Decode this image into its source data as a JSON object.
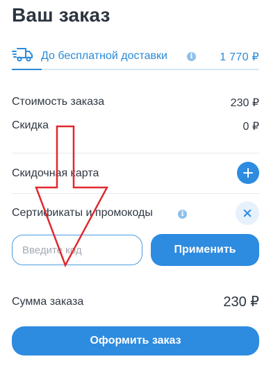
{
  "title": "Ваш заказ",
  "delivery": {
    "label": "До бесплатной доставки",
    "amount": "1 770 ₽",
    "progress_fraction": 0.12,
    "icon": "truck-icon"
  },
  "summary": {
    "cost_label": "Стоимость заказа",
    "cost_value": "230 ₽",
    "discount_label": "Скидка",
    "discount_value": "0 ₽"
  },
  "discount_card": {
    "label": "Скидочная карта",
    "icon": "plus-icon"
  },
  "promo": {
    "label": "Сертификаты и промокоды",
    "input_placeholder": "Введите код",
    "apply_label": "Применить",
    "icon": "close-icon"
  },
  "total": {
    "label": "Сумма заказа",
    "value": "230 ₽"
  },
  "checkout_label": "Оформить заказ",
  "info_glyph": "i",
  "colors": {
    "accent": "#2d8be0",
    "text": "#2f3742",
    "annotation_arrow": "#e0282e"
  }
}
